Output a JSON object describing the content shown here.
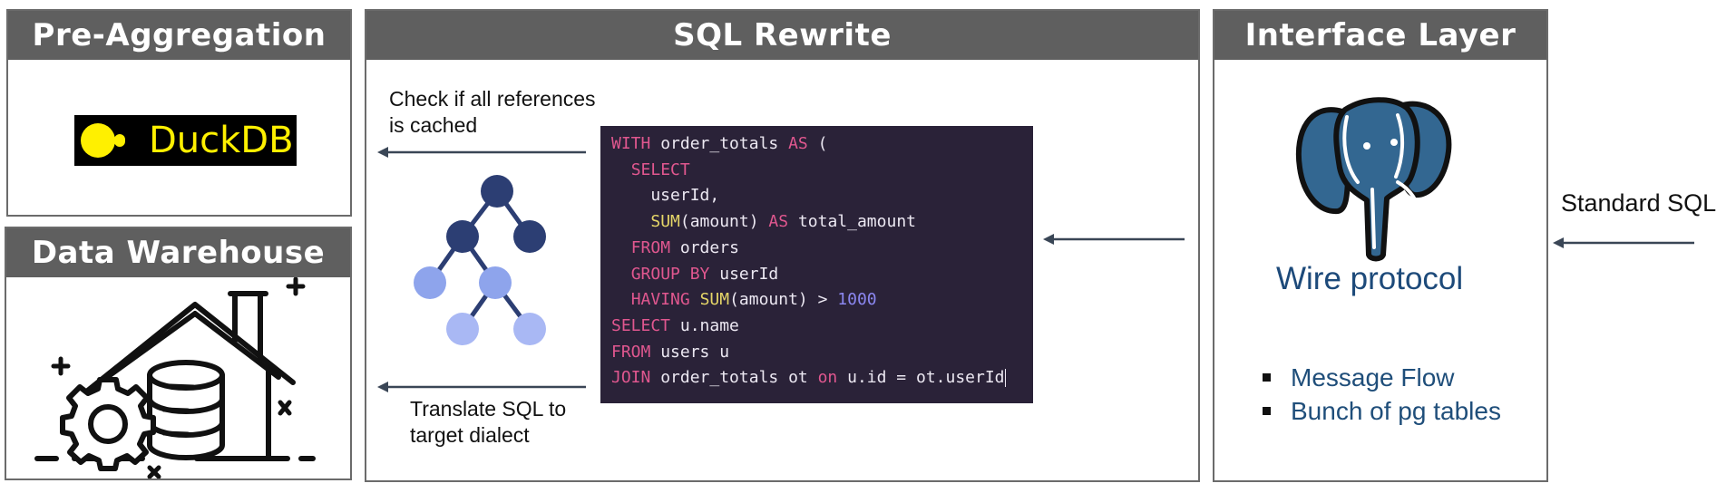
{
  "panels": {
    "pre_aggregation": {
      "title": "Pre-Aggregation"
    },
    "data_warehouse": {
      "title": "Data Warehouse"
    },
    "sql_rewrite": {
      "title": "SQL Rewrite"
    },
    "interface_layer": {
      "title": "Interface Layer"
    }
  },
  "duckdb": {
    "text": "DuckDB"
  },
  "sql_rewrite": {
    "check_label": [
      "Check if all references",
      "is cached"
    ],
    "translate_label": [
      "Translate SQL to",
      "target dialect"
    ],
    "code_lines": [
      [
        {
          "t": "WITH",
          "c": "kw"
        },
        {
          "t": " order_totals "
        },
        {
          "t": "AS",
          "c": "kw"
        },
        {
          "t": " ("
        }
      ],
      [
        {
          "t": "  "
        },
        {
          "t": "SELECT",
          "c": "kw"
        }
      ],
      [
        {
          "t": "    userId,"
        }
      ],
      [
        {
          "t": "    "
        },
        {
          "t": "SUM",
          "c": "fn"
        },
        {
          "t": "(amount) "
        },
        {
          "t": "AS",
          "c": "kw"
        },
        {
          "t": " total_amount"
        }
      ],
      [
        {
          "t": "  "
        },
        {
          "t": "FROM",
          "c": "kw"
        },
        {
          "t": " orders"
        }
      ],
      [
        {
          "t": "  "
        },
        {
          "t": "GROUP BY",
          "c": "kw"
        },
        {
          "t": " userId"
        }
      ],
      [
        {
          "t": "  "
        },
        {
          "t": "HAVING",
          "c": "kw"
        },
        {
          "t": " "
        },
        {
          "t": "SUM",
          "c": "fn"
        },
        {
          "t": "(amount) > "
        },
        {
          "t": "1000",
          "c": "num"
        }
      ],
      [
        {
          "t": "SELECT",
          "c": "kw"
        },
        {
          "t": " u.name"
        }
      ],
      [
        {
          "t": "FROM",
          "c": "kw"
        },
        {
          "t": " users u"
        }
      ],
      [
        {
          "t": "JOIN",
          "c": "kw"
        },
        {
          "t": " order_totals ot "
        },
        {
          "t": "on",
          "c": "kw"
        },
        {
          "t": " u.id = ot.userId"
        }
      ]
    ]
  },
  "interface_layer": {
    "wire_protocol": "Wire protocol",
    "bullets": [
      "Message Flow",
      "Bunch of pg tables"
    ]
  },
  "standard_sql": "Standard SQL",
  "colors": {
    "header_bg": "#5f5f5f",
    "border": "#6b6b6b",
    "code_bg": "#2a2238",
    "keyword": "#e0578f",
    "function": "#e5d668",
    "number": "#8b87f0",
    "arrow": "#3a4656",
    "postgres_blue": "#336791",
    "tree_dark": "#2c3e73",
    "tree_mid": "#8ea4ec",
    "tree_light": "#a9b8f4",
    "duckdb_yellow": "#fff000"
  },
  "icons": [
    "duckdb-logo",
    "warehouse-icon",
    "gear-icon",
    "database-icon",
    "tree-icon",
    "postgres-elephant-icon",
    "arrow-left-icon"
  ]
}
